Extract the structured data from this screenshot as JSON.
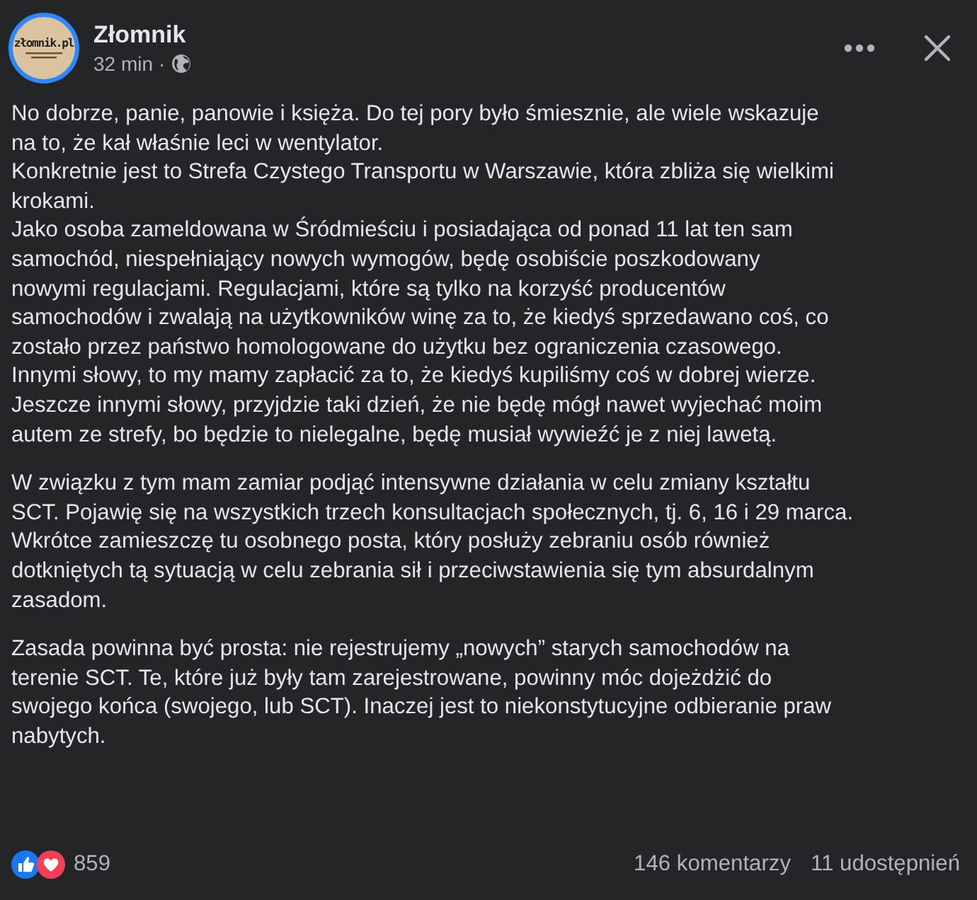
{
  "post": {
    "author": "Złomnik",
    "avatar_text": "złomnik.pl",
    "time": "32 min",
    "separator": "·",
    "paragraphs": [
      [
        "No dobrze, panie, panowie i księża. Do tej pory było śmiesznie, ale wiele wskazuje",
        "na to, że kał właśnie leci w wentylator.",
        "Konkretnie jest to Strefa Czystego Transportu w Warszawie, która zbliża się wielkimi",
        "krokami.",
        "Jako osoba zameldowana w Śródmieściu i posiadająca od ponad 11 lat ten sam",
        "samochód, niespełniający nowych wymogów, będę osobiście poszkodowany",
        "nowymi regulacjami. Regulacjami, które są tylko na korzyść producentów",
        "samochodów i zwalają na użytkowników winę za to, że kiedyś sprzedawano coś, co",
        "zostało przez państwo homologowane do użytku bez ograniczenia czasowego.",
        "Innymi słowy, to my mamy zapłacić za to, że kiedyś kupiliśmy coś w dobrej wierze.",
        "Jeszcze innymi słowy, przyjdzie taki dzień, że nie będę mógł nawet wyjechać moim",
        "autem ze strefy, bo będzie to nielegalne, będę musiał wywieźć je z niej lawetą."
      ],
      [
        "W związku z tym mam zamiar podjąć intensywne działania w celu zmiany kształtu",
        "SCT. Pojawię się na wszystkich trzech konsultacjach społecznych, tj. 6, 16 i 29 marca.",
        "Wkrótce zamieszczę tu osobnego posta, który posłuży zebraniu osób również",
        "dotkniętych tą sytuacją w celu zebrania sił i przeciwstawienia się tym absurdalnym",
        "zasadom."
      ],
      [
        "Zasada powinna być prosta: nie rejestrujemy „nowych” starych samochodów na",
        "terenie SCT. Te, które już były tam zarejestrowane, powinny móc dojeżdżić do",
        "swojego końca (swojego, lub SCT). Inaczej jest to niekonstytucyjne odbieranie praw",
        "nabytych."
      ]
    ],
    "reactions": {
      "count": "859",
      "comments": "146 komentarzy",
      "shares": "11 udostępnień"
    }
  }
}
